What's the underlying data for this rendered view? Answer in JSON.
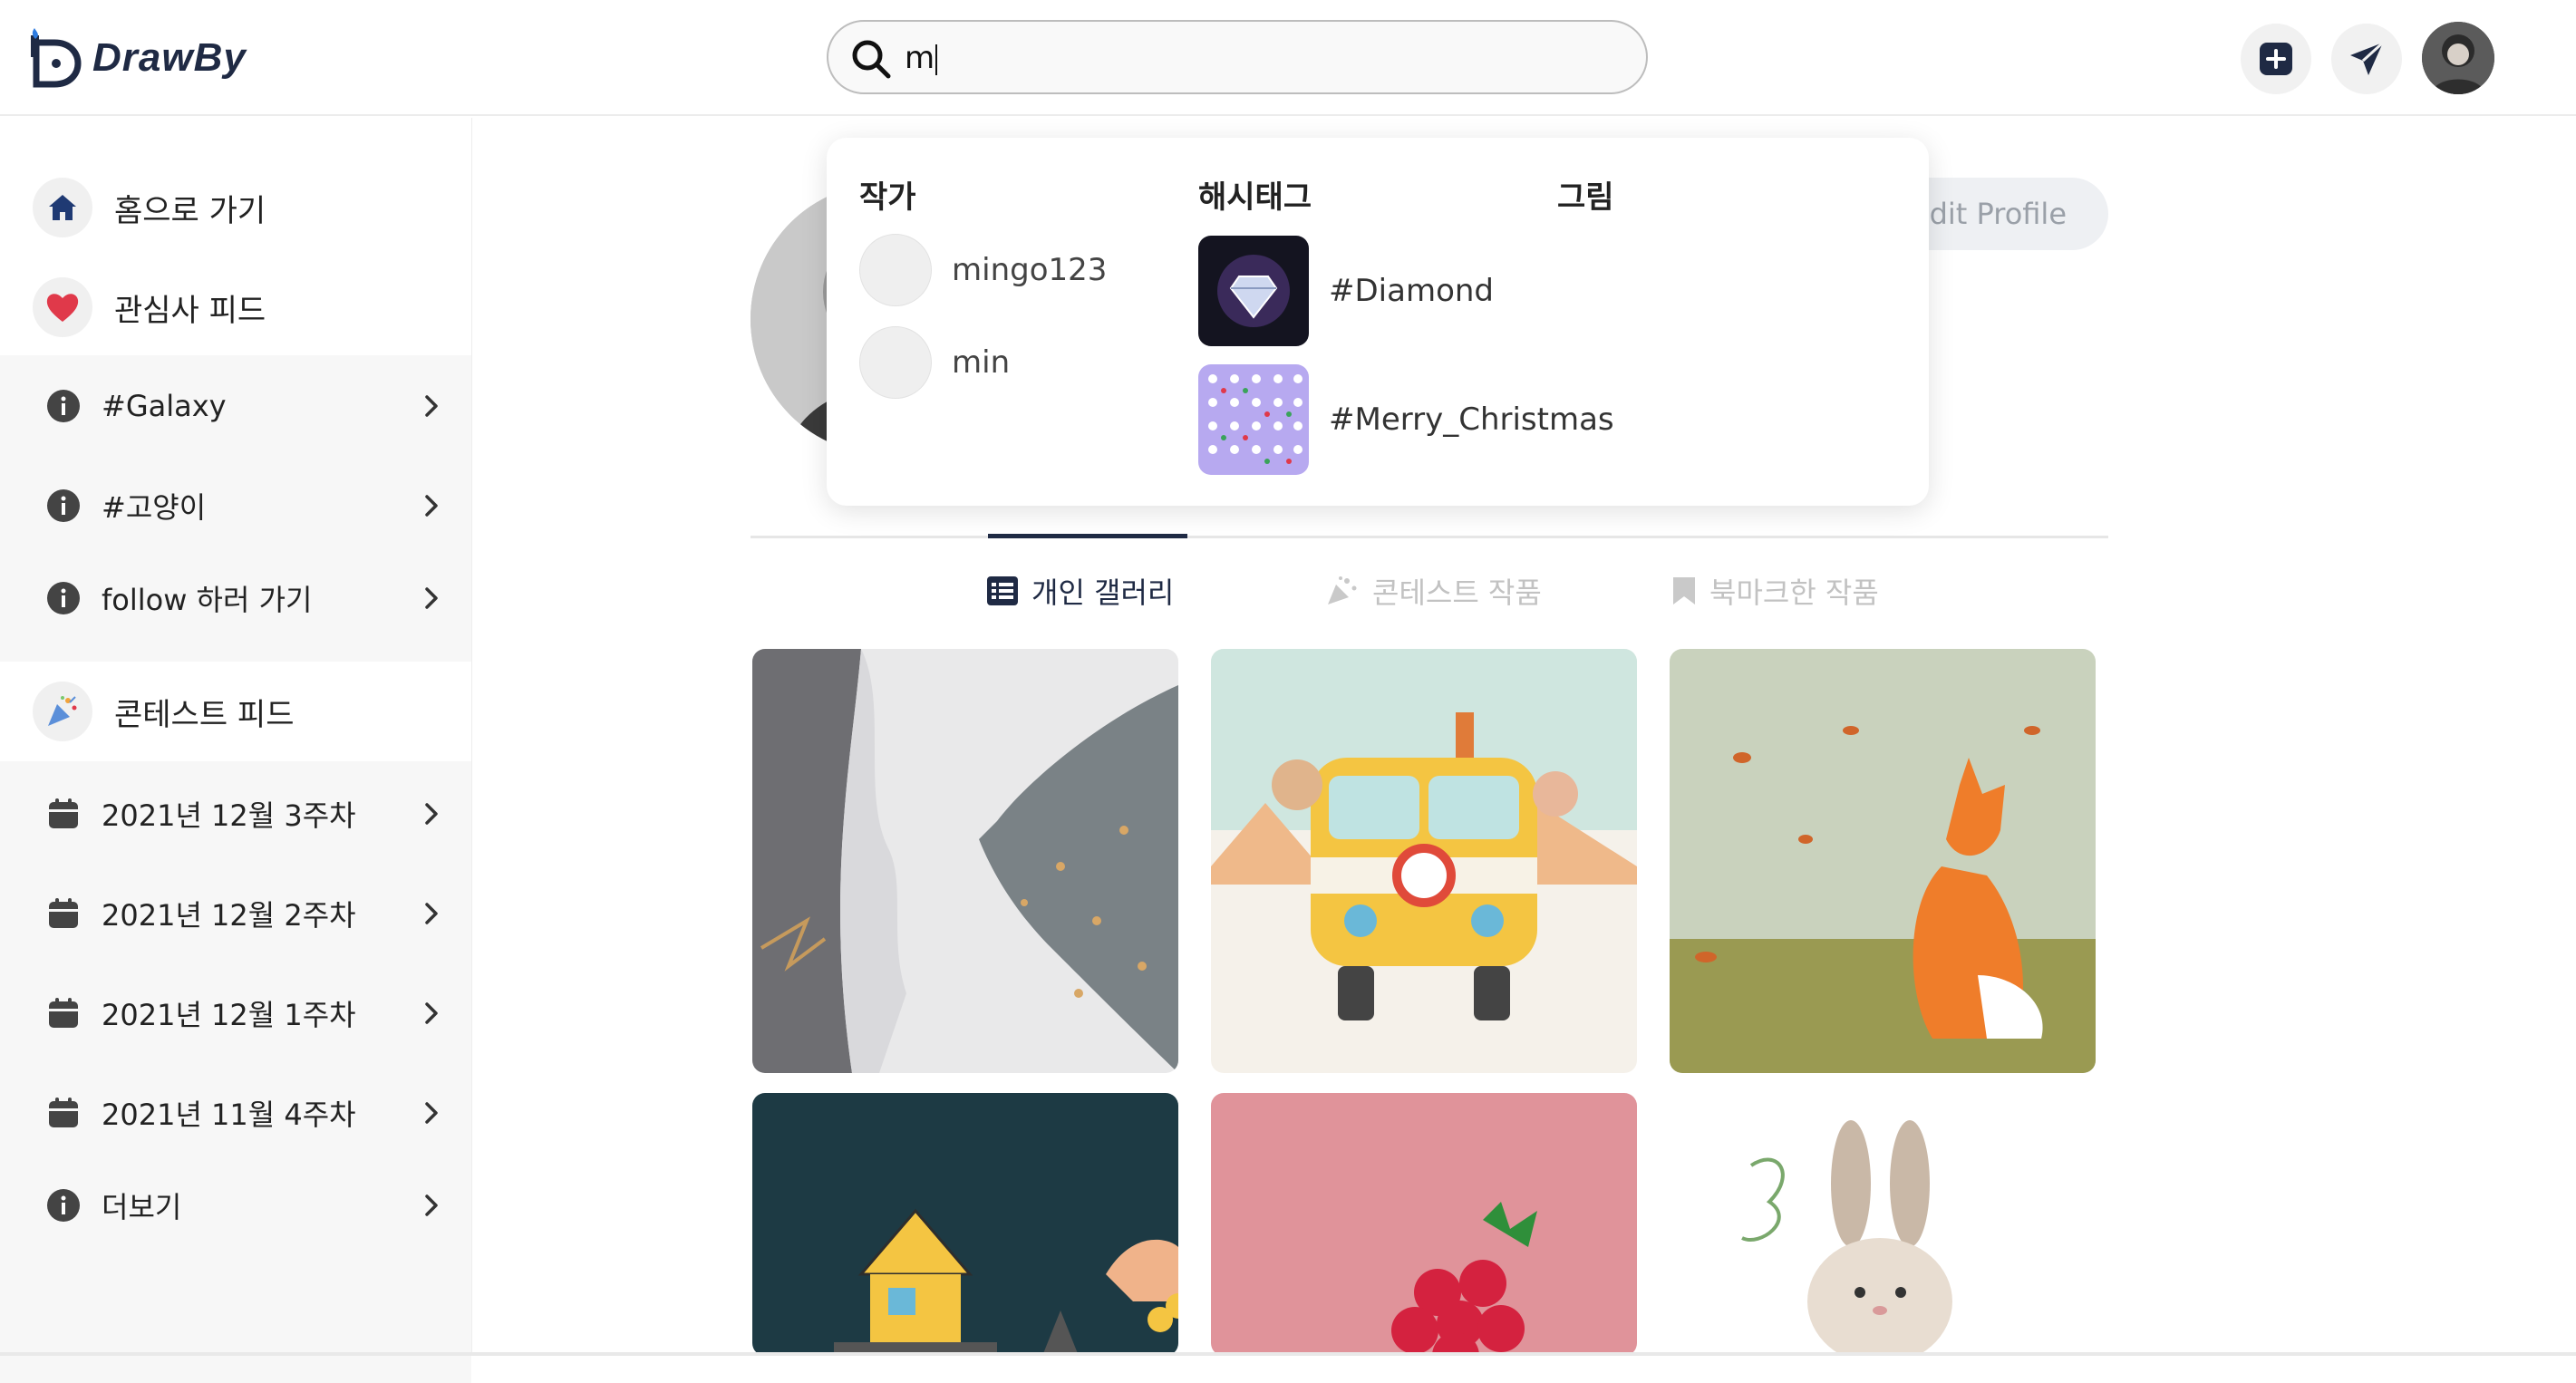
{
  "header": {
    "logo_text": "DrawBy",
    "search_value": "m",
    "icons": [
      "plus-square-icon",
      "paper-plane-icon",
      "avatar"
    ]
  },
  "sidebar": {
    "main_items": [
      {
        "label": "홈으로 가기",
        "icon": "home-icon"
      },
      {
        "label": "관심사 피드",
        "icon": "heart-icon"
      }
    ],
    "interest_items": [
      {
        "label": "#Galaxy",
        "icon": "info-icon"
      },
      {
        "label": "#고양이",
        "icon": "info-icon"
      },
      {
        "label": "follow 하러 가기",
        "icon": "info-icon"
      }
    ],
    "contest_item": {
      "label": "콘테스트 피드",
      "icon": "party-popper-icon"
    },
    "contest_weeks": [
      {
        "label": "2021년 12월 3주차",
        "icon": "calendar-icon"
      },
      {
        "label": "2021년 12월 2주차",
        "icon": "calendar-icon"
      },
      {
        "label": "2021년 12월 1주차",
        "icon": "calendar-icon"
      },
      {
        "label": "2021년 11월 4주차",
        "icon": "calendar-icon"
      },
      {
        "label": "더보기",
        "icon": "info-icon"
      }
    ]
  },
  "profile": {
    "edit_label": "Edit Profile"
  },
  "tabs": [
    {
      "label": "개인 갤러리",
      "active": true,
      "icon": "list-icon"
    },
    {
      "label": "콘테스트 작품",
      "active": false,
      "icon": "party-popper-icon"
    },
    {
      "label": "북마크한 작품",
      "active": false,
      "icon": "bookmark-icon"
    }
  ],
  "search_dropdown": {
    "headers": {
      "authors": "작가",
      "hashtags": "해시태그",
      "drawings": "그림"
    },
    "authors": [
      {
        "name": "mingo123"
      },
      {
        "name": "min"
      }
    ],
    "hashtags": [
      {
        "name": "#Diamond"
      },
      {
        "name": "#Merry_Christmas"
      }
    ]
  },
  "colors": {
    "brand_navy": "#1f2a44",
    "heart_red": "#e0394a",
    "sidebar_band": "#f7f7f7"
  }
}
